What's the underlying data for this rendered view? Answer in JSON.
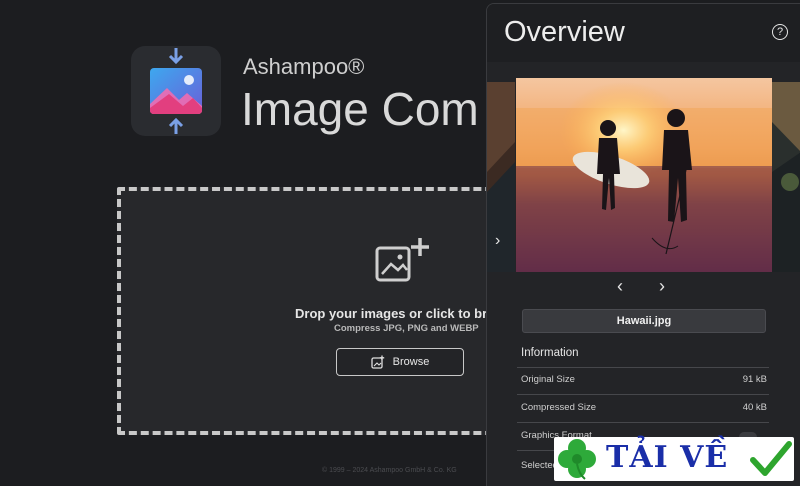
{
  "app": {
    "brand_small": "Ashampoo®",
    "brand_big": "Image Com",
    "drop_title": "Drop your images or click to brow",
    "drop_subtitle": "Compress JPG, PNG and WEBP",
    "browse_label": "Browse",
    "copyright": "© 1999 – 2024 Ashampoo GmbH & Co. KG"
  },
  "overview": {
    "title": "Overview",
    "help_glyph": "?",
    "strip_arrow": "›",
    "prev_glyph": "‹",
    "next_glyph": "›",
    "filename": "Hawaii.jpg",
    "info_heading": "Information",
    "rows": [
      {
        "label": "Original Size",
        "value": "91 kB"
      },
      {
        "label": "Compressed Size",
        "value": "40 kB"
      },
      {
        "label": "Graphics Format",
        "value": ""
      },
      {
        "label": "Selected",
        "value": ""
      }
    ]
  },
  "watermark": {
    "text": "TẢI VỀ"
  },
  "colors": {
    "background": "#1c1d20",
    "panel": "#232427",
    "accent_blue": "#3b8fd9",
    "watermark_text": "#1a2ea8",
    "watermark_check": "#2ea52e"
  }
}
